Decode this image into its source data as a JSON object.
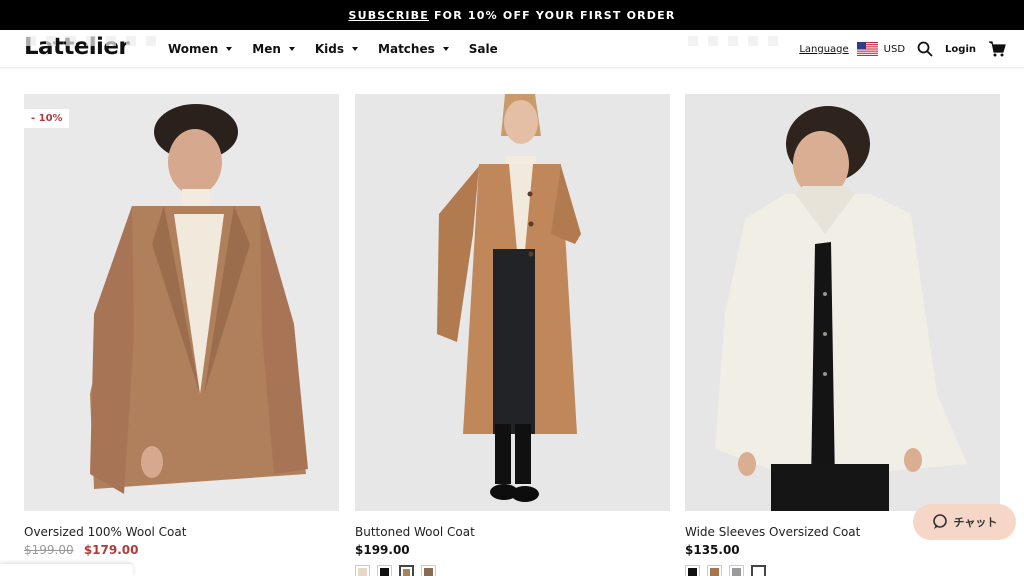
{
  "promo": {
    "link": "SUBSCRIBE",
    "text": "FOR 10% OFF YOUR FIRST ORDER"
  },
  "header": {
    "logo": "Lattelier",
    "nav": [
      {
        "label": "Women",
        "has_menu": true
      },
      {
        "label": "Men",
        "has_menu": true
      },
      {
        "label": "Kids",
        "has_menu": true
      },
      {
        "label": "Matches",
        "has_menu": true
      },
      {
        "label": "Sale",
        "has_menu": false
      }
    ],
    "language": "Language",
    "currency": "USD",
    "login": "Login"
  },
  "products": [
    {
      "badge": "- 10%",
      "name": "Oversized 100% Wool Coat",
      "old_price": "$199.00",
      "price": "$179.00",
      "coat_color": "#b07f5c",
      "swatches": []
    },
    {
      "badge": "",
      "name": "Buttoned Wool Coat",
      "old_price": "",
      "price": "$199.00",
      "coat_color": "#c0875a",
      "swatches": [
        "#e8d8c8",
        "#111111",
        "#a8845c",
        "#8b6a52"
      ],
      "selected_swatch": 2
    },
    {
      "badge": "",
      "name": "Wide Sleeves Oversized Coat",
      "old_price": "",
      "price": "$135.00",
      "coat_color": "#f1eee6",
      "swatches": [
        "#111111",
        "#a8744c",
        "#9a9a9a",
        "#ffffff"
      ],
      "selected_swatch": 3
    }
  ],
  "chat": {
    "label": "チャット"
  },
  "colors": {
    "accent_sale": "#b23a3a",
    "chat_bg": "#f6d7c7",
    "promo_bg": "#000000"
  }
}
